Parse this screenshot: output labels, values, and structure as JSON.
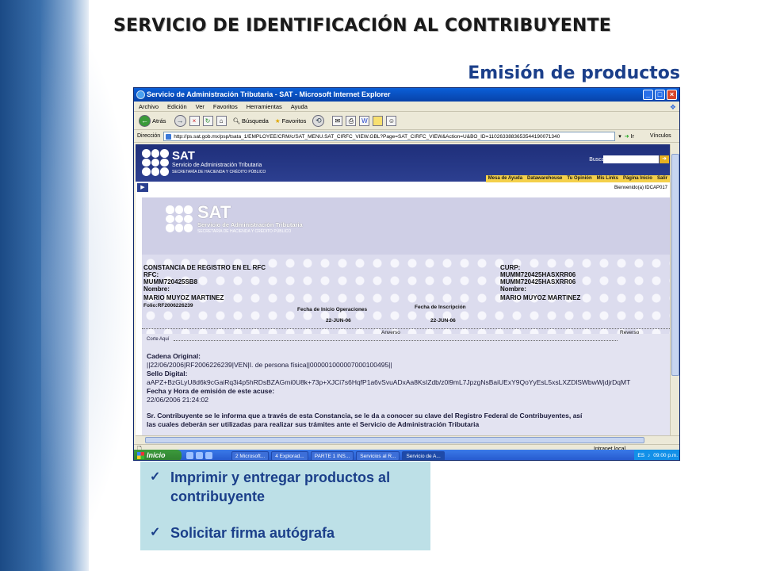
{
  "slide": {
    "title": "SERVICIO DE IDENTIFICACIÓN AL CONTRIBUYENTE",
    "subtitle": "Emisión de productos"
  },
  "browser": {
    "window_title": "Servicio de Administración Tributaria - SAT - Microsoft Internet Explorer",
    "menu": [
      "Archivo",
      "Edición",
      "Ver",
      "Favoritos",
      "Herramientas",
      "Ayuda"
    ],
    "toolbar": {
      "back": "Atrás",
      "search": "Búsqueda",
      "favorites": "Favoritos"
    },
    "address_label": "Dirección",
    "address_value": "http://ps.sat.gob.mx/psp/tsata_1/EMPLOYEE/CRM/c/SAT_MENU.SAT_CIRFC_VIEW.GBL?Page=SAT_CIRFC_VIEW&Action=U&BO_ID=1102633883653544190071340",
    "go_label": "Ir",
    "links_label": "Vínculos",
    "status_zone": "Intranet local"
  },
  "sat_portal": {
    "logo": "SAT",
    "name": "Servicio de Administración Tributaria",
    "dept": "SECRETARÍA DE HACIENDA Y CRÉDITO PÚBLICO",
    "search_label": "Buscar",
    "links": [
      "Mesa de Ayuda",
      "Datawarehouse",
      "Tu Opinión",
      "Mis Links",
      "Página Inicio",
      "Salir"
    ],
    "welcome": "Bienvenido(a) IDCAP017"
  },
  "certificate": {
    "logo": "SAT",
    "name": "Servicio de Administración Tributaria",
    "dept": "SECRETARÍA DE HACIENDA Y CRÉDITO PÚBLICO",
    "doc_title": "CONSTANCIA DE REGISTRO EN EL RFC",
    "rfc_label": "RFC:",
    "rfc_value": "MUMM720425SB8",
    "name_label": "Nombre:",
    "name_value": "MARIO MUYOZ MARTINEZ",
    "folio": "Folio:RF2006226239",
    "curp_label": "CURP:",
    "curp_value1": "MUMM720425HASXRR06",
    "curp_value2": "MUMM720425HASXRR06",
    "name_label_r": "Nombre:",
    "name_value_r": "MARIO MUYOZ MARTINEZ",
    "start_ops_label": "Fecha de Inicio Operaciones",
    "start_ops_value": "22-JUN-06",
    "inscription_label": "Fecha de Inscripción",
    "inscription_value": "22-JUN-06",
    "anverso": "Anverso",
    "reverso": "Reverso",
    "corte": "Corte Aquí",
    "cadena_label": "Cadena Original:",
    "cadena_value": "||22/06/2006|RF2006226239|VEN|I. de persona física||000001000007000100495||",
    "sello_label": "Sello Digital:",
    "sello_value": "aAPZ+BzGLyU8d6k9cGaiRq3i4p5hRDsBZAGmi0U8k+73p+XJCi7s6HqfP1a6vSvuADxAa8KsIZdb/z0l9mL7JpzgNsBaiUExY9QoYyEsL5xsLXZDlSWbwWjdjrDqMT",
    "fecha_label": "Fecha y Hora de emisión de este acuse:",
    "fecha_value": "22/06/2006 21:24:02",
    "notice1": "Sr. Contribuyente se le informa que a través de esta Constancia, se le da a conocer su clave del Registro Federal de Contribuyentes, así",
    "notice2": "las cuales deberán ser utilizadas para realizar sus trámites ante el Servicio de Administración Tributaria"
  },
  "taskbar": {
    "start": "Inicio",
    "items": [
      "2 Microsoft...",
      "4 Explorad...",
      "PARTE 1 INS...",
      "Servicios al R...",
      "Servicio de A..."
    ],
    "lang": "ES",
    "clock": "09:00 p.m."
  },
  "bullets": [
    {
      "text": "Imprimir y entregar productos al contribuyente"
    },
    {
      "text": "Solicitar firma autógrafa"
    }
  ],
  "colors": {
    "slide_accent": "#1b3f8a",
    "bullet_box": "#bde0e7",
    "sat_header": "#1f2f7a"
  }
}
